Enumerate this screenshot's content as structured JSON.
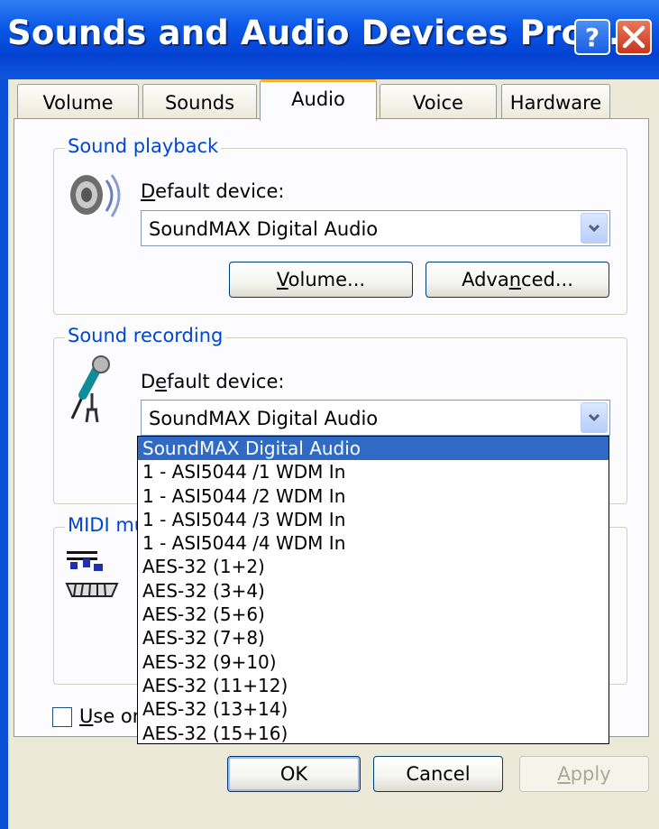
{
  "window": {
    "title": "Sounds and Audio Devices Prop..."
  },
  "tabs": [
    {
      "label": "Volume"
    },
    {
      "label": "Sounds"
    },
    {
      "label": "Audio"
    },
    {
      "label": "Voice"
    },
    {
      "label": "Hardware"
    }
  ],
  "active_tab": "Audio",
  "playback": {
    "group_label": "Sound playback",
    "default_label": "Default device:",
    "device": "SoundMAX Digital Audio",
    "volume_button": "Volume...",
    "advanced_button": "Advanced..."
  },
  "recording": {
    "group_label": "Sound recording",
    "default_label": "Default device:",
    "device": "SoundMAX Digital Audio",
    "options": [
      "SoundMAX Digital Audio",
      "1 - ASI5044 /1 WDM In",
      "1 - ASI5044 /2 WDM In",
      "1 - ASI5044 /3 WDM In",
      "1 - ASI5044 /4 WDM In",
      "AES-32 (1+2)",
      "AES-32 (3+4)",
      "AES-32 (5+6)",
      "AES-32 (7+8)",
      "AES-32 (9+10)",
      "AES-32 (11+12)",
      "AES-32 (13+14)",
      "AES-32 (15+16)"
    ]
  },
  "midi": {
    "group_label": "MIDI mu"
  },
  "checkbox": {
    "label": "Use on"
  },
  "footer": {
    "ok": "OK",
    "cancel": "Cancel",
    "apply": "Apply"
  },
  "colors": {
    "titlebar": "#0a57e8",
    "group_label": "#0046d5",
    "selection": "#316ac5",
    "tab_highlight": "#f4b12e"
  }
}
